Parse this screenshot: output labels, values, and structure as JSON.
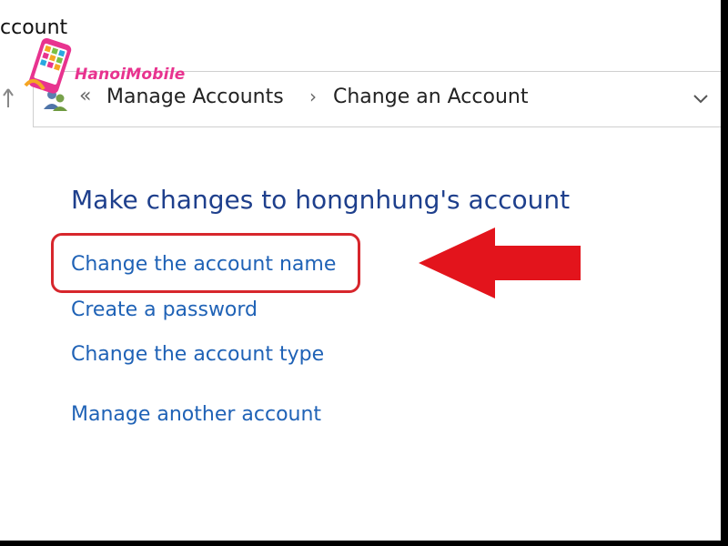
{
  "window": {
    "title": "ccount"
  },
  "logo": {
    "text": "HanoiMobile"
  },
  "breadcrumb": {
    "items": [
      "Manage Accounts",
      "Change an Account"
    ],
    "double_separator": "«",
    "separator": "›"
  },
  "main": {
    "heading": "Make changes to hongnhung's account",
    "links": [
      "Change the account name",
      "Create a password",
      "Change the account type",
      "Manage another account"
    ]
  },
  "annotation": {
    "highlighted_item": "Change the account name",
    "arrow_color": "#e3141c",
    "box_color": "#d7262c"
  },
  "colors": {
    "link": "#1f62b6",
    "heading": "#1e3f8c"
  },
  "icons": {
    "up": "up-arrow-icon",
    "users": "users-icon",
    "dropdown": "chevron-down-icon"
  }
}
